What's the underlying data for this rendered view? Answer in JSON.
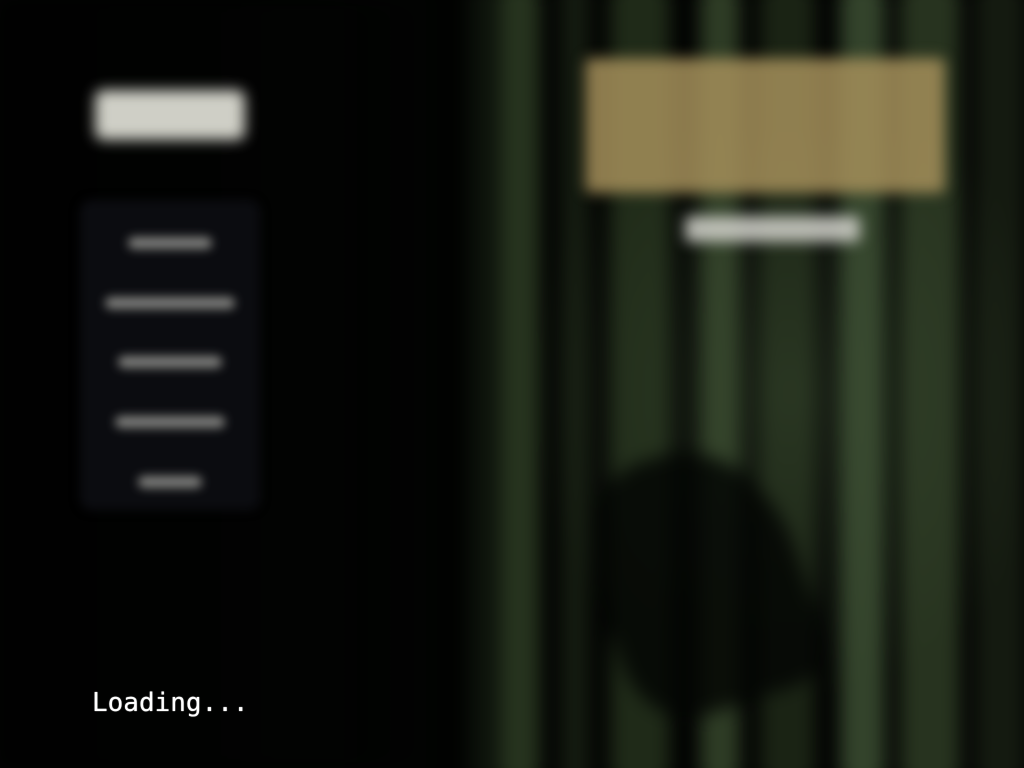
{
  "screen": {
    "type": "game-main-menu",
    "state": "loading"
  },
  "menu": {
    "header_visible": true,
    "item_count": 5
  },
  "logo": {
    "has_title": true,
    "has_subtitle": true
  },
  "status": {
    "loading_text": "Loading..."
  },
  "colors": {
    "background": "#020302",
    "forest_green": "#2c3a24",
    "logo_gold": "#a58f5a",
    "menu_panel": "#0c0d12",
    "text": "#ffffff"
  }
}
